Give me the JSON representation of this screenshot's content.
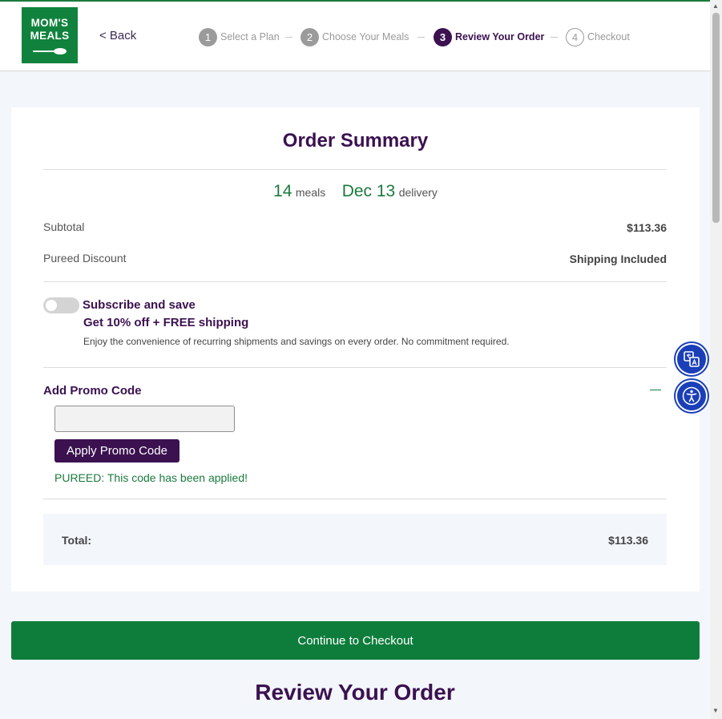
{
  "header": {
    "logo_line1": "MOM'S",
    "logo_line2": "MEALS",
    "back_label": "< Back",
    "steps": [
      {
        "num": "1",
        "label": "Select a Plan",
        "state": "done"
      },
      {
        "num": "2",
        "label": "Choose Your Meals",
        "state": "done"
      },
      {
        "num": "3",
        "label": "Review Your Order",
        "state": "active"
      },
      {
        "num": "4",
        "label": "Checkout",
        "state": "todo"
      }
    ]
  },
  "summary": {
    "title": "Order Summary",
    "meals_count": "14",
    "meals_label": "meals",
    "delivery_date": "Dec 13",
    "delivery_label": "delivery",
    "subtotal_label": "Subtotal",
    "subtotal_value": "$113.36",
    "discount_label": "Pureed Discount",
    "discount_value": "Shipping Included"
  },
  "subscribe": {
    "enabled": false,
    "title": "Subscribe and save",
    "offer": "Get 10% off + FREE shipping",
    "description": "Enjoy the convenience of recurring shipments and savings on every order. No commitment required."
  },
  "promo": {
    "title": "Add Promo Code",
    "input_value": "",
    "button_label": "Apply Promo Code",
    "message": "PUREED: This code has been applied!"
  },
  "total": {
    "label": "Total:",
    "value": "$113.36"
  },
  "continue_label": "Continue to Checkout",
  "section_title": "Review Your Order",
  "colors": {
    "brand_green": "#10823d",
    "brand_purple": "#3b1150",
    "accessibility_blue": "#1b3fb8"
  },
  "icons": [
    "spoon-icon",
    "translate-icon",
    "accessibility-icon"
  ]
}
